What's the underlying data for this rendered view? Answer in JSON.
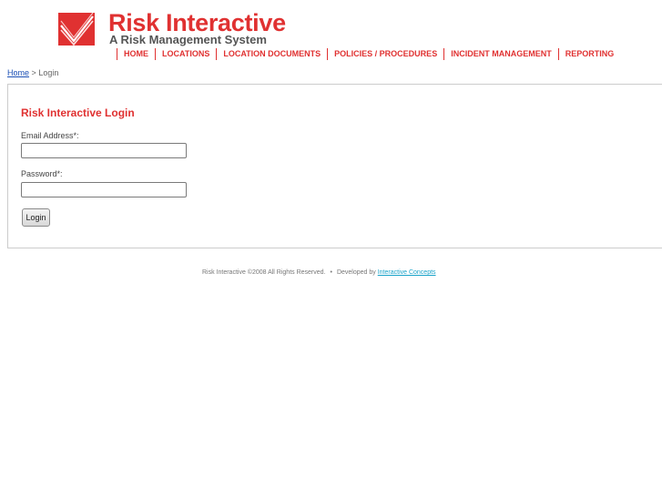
{
  "header": {
    "brand_name": "Risk Interactive",
    "tagline": "A Risk Management System",
    "logo_icon": "check-chevron-logo-icon",
    "brand_color": "#e03131"
  },
  "nav": {
    "items": [
      {
        "label": "HOME"
      },
      {
        "label": "LOCATIONS"
      },
      {
        "label": "LOCATION DOCUMENTS"
      },
      {
        "label": "POLICIES / PROCEDURES"
      },
      {
        "label": "INCIDENT MANAGEMENT"
      },
      {
        "label": "REPORTING"
      }
    ]
  },
  "breadcrumb": {
    "home_label": "Home",
    "separator": ">",
    "current": "Login"
  },
  "login": {
    "title": "Risk Interactive Login",
    "email_label": "Email Address*:",
    "email_value": "",
    "password_label": "Password*:",
    "password_value": "",
    "button_label": "Login"
  },
  "footer": {
    "copyright": "Risk Interactive ©2008 All Rights Reserved.",
    "separator": "•",
    "developed_by": "Developed by",
    "developer_link": "Interactive Concepts",
    "link_color": "#1aa3c9"
  }
}
